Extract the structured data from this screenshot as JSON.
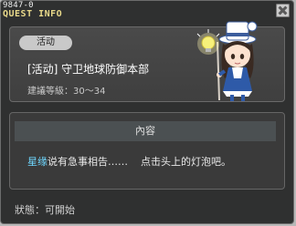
{
  "window": {
    "id_text": "9847-0",
    "title": "QUEST INFO"
  },
  "quest": {
    "category_badge": "活动",
    "name": "[活动] 守卫地球防御本部",
    "level_label": "建議等級：30～34"
  },
  "content": {
    "header": "內容",
    "npc_name": "星缘",
    "text_part1": "说有急事相告……",
    "text_part2": "点击头上的灯泡吧。"
  },
  "status": {
    "text": "狀態：可開始"
  },
  "colors": {
    "accent_title": "#e9d98a",
    "npc_link": "#6fd7ff"
  }
}
